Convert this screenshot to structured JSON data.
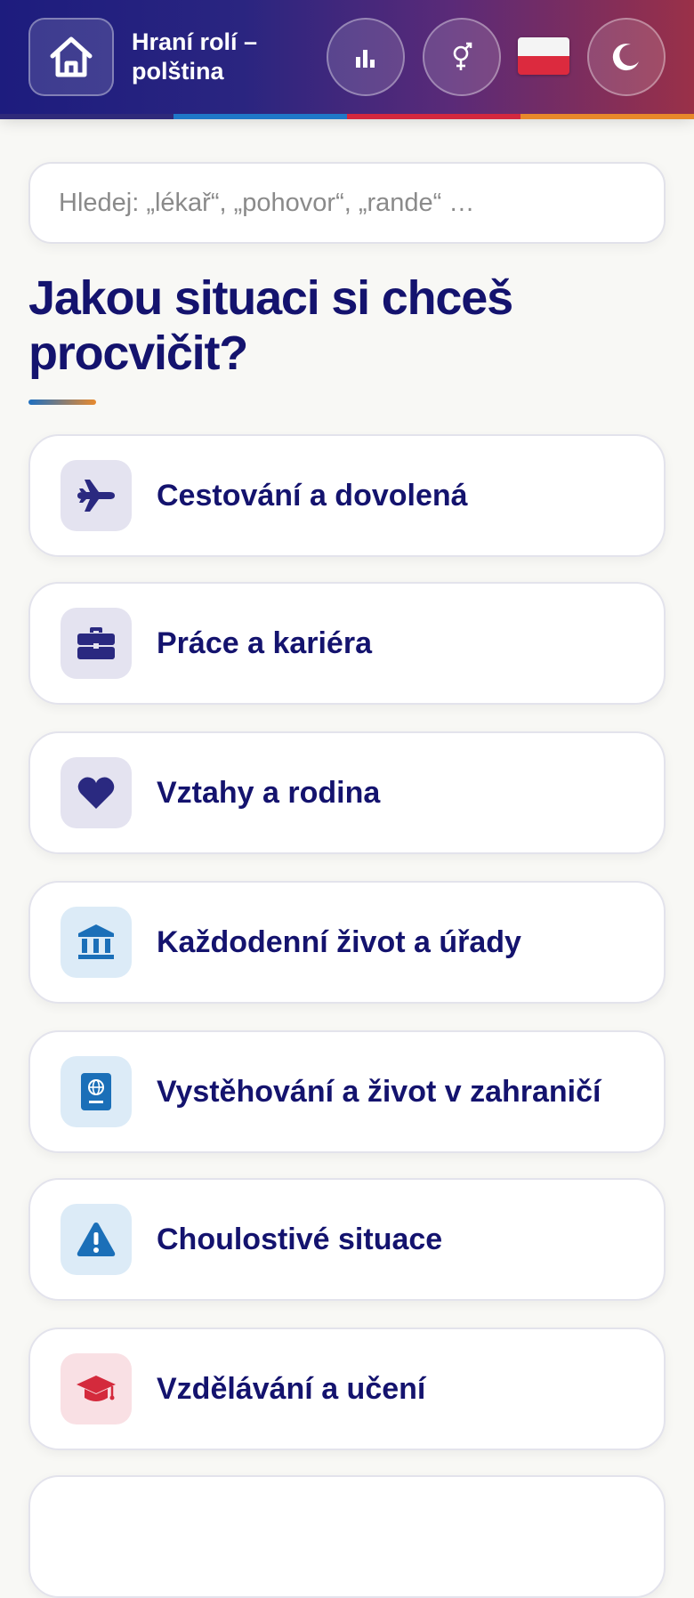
{
  "header": {
    "title": "Hraní rolí – polština",
    "buttons": {
      "home": "home-icon",
      "stats": "bar-chart-icon",
      "gender": "gender-icon",
      "language_flag": "poland-flag-icon",
      "theme": "moon-icon"
    },
    "stripe_colors": [
      "#2f2a7a",
      "#1f78c8",
      "#d4283e",
      "#e8882a"
    ]
  },
  "search": {
    "placeholder": "Hledej: „lékař“, „pohovor“, „rande“ …",
    "value": ""
  },
  "main": {
    "heading": "Jakou situaci si chceš procvičit?",
    "categories": [
      {
        "label": "Cestování a dovolená",
        "icon": "airplane-icon",
        "color": "#2a2980"
      },
      {
        "label": "Práce a kariéra",
        "icon": "briefcase-icon",
        "color": "#2a2980"
      },
      {
        "label": "Vztahy a rodina",
        "icon": "heart-icon",
        "color": "#2a2980"
      },
      {
        "label": "Každodenní život a úřady",
        "icon": "landmark-icon",
        "color": "#1b6fb8"
      },
      {
        "label": "Vystěhování a život v zahraničí",
        "icon": "passport-icon",
        "color": "#1b6fb8"
      },
      {
        "label": "Choulostivé situace",
        "icon": "warning-icon",
        "color": "#1b6fb8"
      },
      {
        "label": "Vzdělávání a učení",
        "icon": "graduation-cap-icon",
        "color": "#d42a3c"
      }
    ]
  }
}
